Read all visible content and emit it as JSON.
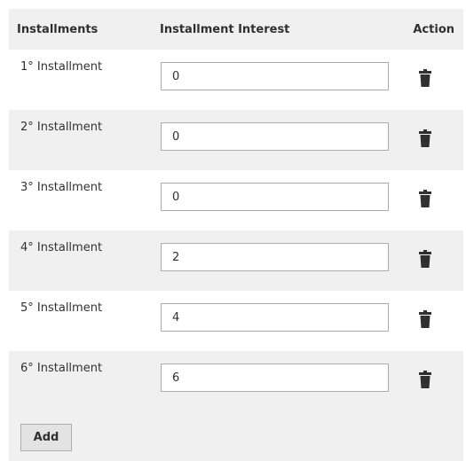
{
  "header": {
    "col_installments": "Installments",
    "col_interest": "Installment Interest",
    "col_action": "Action"
  },
  "rows": [
    {
      "label": "1° Installment",
      "value": "0"
    },
    {
      "label": "2° Installment",
      "value": "0"
    },
    {
      "label": "3° Installment",
      "value": "0"
    },
    {
      "label": "4° Installment",
      "value": "2"
    },
    {
      "label": "5° Installment",
      "value": "4"
    },
    {
      "label": "6° Installment",
      "value": "6"
    }
  ],
  "footer": {
    "add_label": "Add"
  },
  "icons": {
    "delete": "trash-icon"
  },
  "colors": {
    "row_alt_bg": "#f0f0f0",
    "icon": "#303030",
    "input_border": "#adadad"
  }
}
